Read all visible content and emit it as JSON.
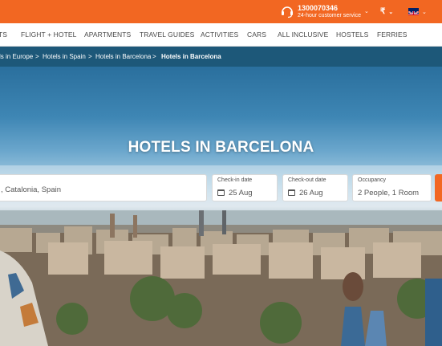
{
  "support": {
    "phone": "1300070346",
    "subtitle": "24-hour customer service"
  },
  "currency": {
    "symbol": "₹"
  },
  "language": {
    "flag_icon": "uk-flag-icon"
  },
  "nav": {
    "items": [
      {
        "label": "TS"
      },
      {
        "label": "FLIGHT + HOTEL"
      },
      {
        "label": "APARTMENTS"
      },
      {
        "label": "TRAVEL GUIDES"
      },
      {
        "label": "ACTIVITIES"
      },
      {
        "label": "CARS"
      },
      {
        "label": "ALL INCLUSIVE"
      },
      {
        "label": "HOSTELS"
      },
      {
        "label": "FERRIES"
      }
    ]
  },
  "breadcrumb": {
    "items": [
      {
        "label": "ls in Europe"
      },
      {
        "label": "Hotels in Spain"
      },
      {
        "label": "Hotels in Barcelona"
      },
      {
        "label": "Hotels in Barcelona"
      }
    ],
    "separator": ">"
  },
  "hero": {
    "title": "HOTELS IN BARCELONA"
  },
  "search": {
    "destination_value": ", Catalonia, Spain",
    "checkin": {
      "label": "Check-in date",
      "value": "25 Aug"
    },
    "checkout": {
      "label": "Check-out date",
      "value": "26 Aug"
    },
    "occupancy": {
      "label": "Occupancy",
      "value": "2 People, 1 Room"
    }
  },
  "colors": {
    "brand_orange": "#f26722",
    "breadcrumb_bg": "#1d5879"
  }
}
